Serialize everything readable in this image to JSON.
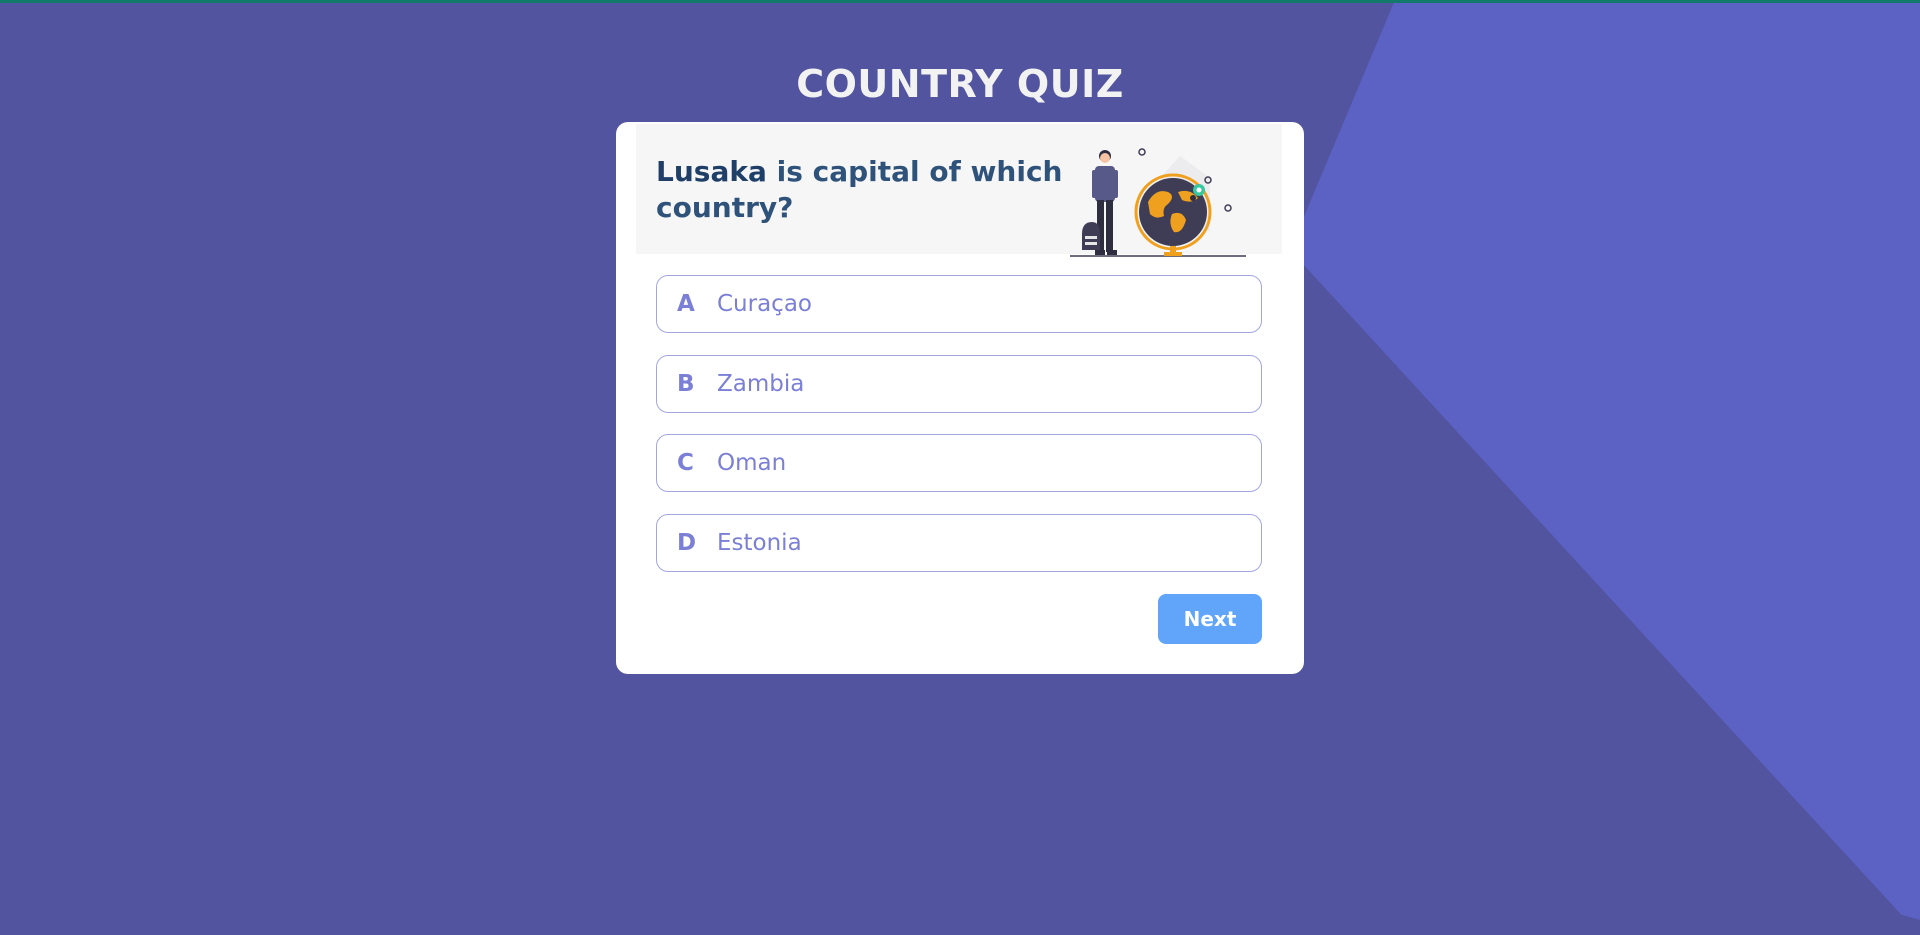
{
  "page": {
    "title": "COUNTRY QUIZ"
  },
  "question": {
    "city": "Lusaka",
    "rest": " is capital of which country?"
  },
  "options": [
    {
      "letter": "A",
      "text": "Curaçao"
    },
    {
      "letter": "B",
      "text": "Zambia"
    },
    {
      "letter": "C",
      "text": "Oman"
    },
    {
      "letter": "D",
      "text": "Estonia"
    }
  ],
  "actions": {
    "next_label": "Next"
  },
  "colors": {
    "background": "#5254a0",
    "background_shape": "#5c62c4",
    "accent": "#7c7fd6",
    "question_text": "#2f527b",
    "next_button": "#60a5fa"
  },
  "icons": {
    "illustration": "person-with-globe-illustration"
  }
}
